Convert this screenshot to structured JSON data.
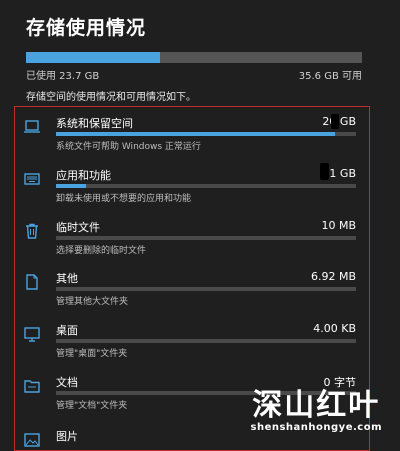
{
  "page": {
    "title": "存储使用情况",
    "used": "已使用 23.7 GB",
    "available": "35.6 GB 可用",
    "used_fraction": 0.4,
    "description": "存储空间的使用情况和可用情况如下。"
  },
  "colors": {
    "accent": "#4aa3df",
    "background": "#1f1f1f",
    "highlight": "#c42b2b"
  },
  "categories": [
    {
      "name": "系统和保留空间",
      "size": "20  GB",
      "sub": "系统文件可帮助 Windows 正常运行",
      "fraction": 0.93,
      "icon": "laptop-icon"
    },
    {
      "name": "应用和功能",
      "size": ".61 GB",
      "sub": "卸载未使用或不想要的应用和功能",
      "fraction": 0.1,
      "icon": "keyboard-icon"
    },
    {
      "name": "临时文件",
      "size": "10  MB",
      "sub": "选择要删除的临时文件",
      "fraction": 0.0,
      "icon": "trash-icon"
    },
    {
      "name": "其他",
      "size": "6.92 MB",
      "sub": "管理其他大文件夹",
      "fraction": 0.0,
      "icon": "document-icon"
    },
    {
      "name": "桌面",
      "size": "4.00 KB",
      "sub": "管理\"桌面\"文件夹",
      "fraction": 0.0,
      "icon": "monitor-icon"
    },
    {
      "name": "文档",
      "size": "0 字节",
      "sub": "管理\"文档\"文件夹",
      "fraction": 0.0,
      "icon": "folder-icon"
    },
    {
      "name": "图片",
      "size": "",
      "sub": "",
      "fraction": 0.0,
      "icon": "picture-icon"
    }
  ],
  "watermark": {
    "main": "深山红叶",
    "sub": "shenshanhongye.com"
  }
}
